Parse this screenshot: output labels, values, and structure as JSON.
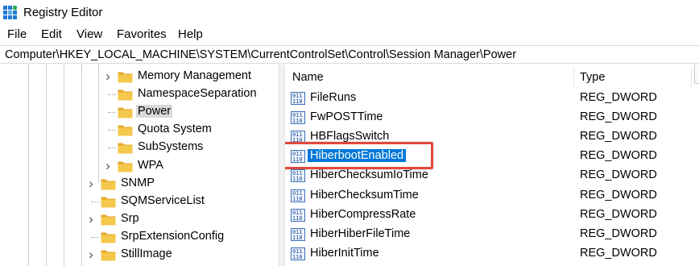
{
  "window": {
    "title": "Registry Editor",
    "app_icon": "regedit-icon"
  },
  "menu": {
    "items": [
      "File",
      "Edit",
      "View",
      "Favorites",
      "Help"
    ]
  },
  "address": {
    "path": "Computer\\HKEY_LOCAL_MACHINE\\SYSTEM\\CurrentControlSet\\Control\\Session Manager\\Power"
  },
  "tree": {
    "nodes": [
      {
        "label": "Memory Management",
        "expandable": true,
        "selected": false
      },
      {
        "label": "NamespaceSeparation",
        "expandable": false,
        "selected": false
      },
      {
        "label": "Power",
        "expandable": false,
        "selected": true
      },
      {
        "label": "Quota System",
        "expandable": false,
        "selected": false
      },
      {
        "label": "SubSystems",
        "expandable": false,
        "selected": false
      },
      {
        "label": "WPA",
        "expandable": true,
        "selected": false
      },
      {
        "label": "SNMP",
        "expandable": true,
        "selected": false
      },
      {
        "label": "SQMServiceList",
        "expandable": false,
        "selected": false
      },
      {
        "label": "Srp",
        "expandable": true,
        "selected": false
      },
      {
        "label": "SrpExtensionConfig",
        "expandable": false,
        "selected": false
      },
      {
        "label": "StillImage",
        "expandable": true,
        "selected": false
      }
    ],
    "folder_color": "#f4c84c"
  },
  "values": {
    "columns": {
      "name": "Name",
      "type": "Type"
    },
    "rows": [
      {
        "name": "FileRuns",
        "type": "REG_DWORD"
      },
      {
        "name": "FwPOSTTime",
        "type": "REG_DWORD"
      },
      {
        "name": "HBFlagsSwitch",
        "type": "REG_DWORD"
      },
      {
        "name": "HiberbootEnabled",
        "type": "REG_DWORD",
        "selected": true
      },
      {
        "name": "HiberChecksumIoTime",
        "type": "REG_DWORD"
      },
      {
        "name": "HiberChecksumTime",
        "type": "REG_DWORD"
      },
      {
        "name": "HiberCompressRate",
        "type": "REG_DWORD"
      },
      {
        "name": "HiberHiberFileTime",
        "type": "REG_DWORD"
      },
      {
        "name": "HiberInitTime",
        "type": "REG_DWORD"
      }
    ],
    "selection_color": "#0078d7",
    "highlight_color": "#e04a3c"
  }
}
